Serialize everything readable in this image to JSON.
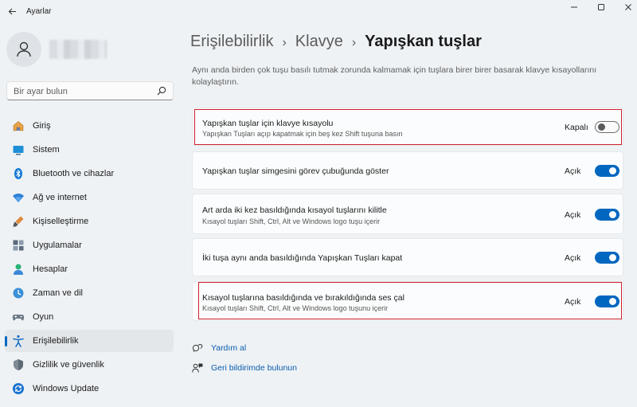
{
  "window": {
    "title": "Ayarlar"
  },
  "search": {
    "placeholder": "Bir ayar bulun"
  },
  "sidebar": {
    "items": [
      {
        "label": "Giriş",
        "icon": "home-icon"
      },
      {
        "label": "Sistem",
        "icon": "system-icon"
      },
      {
        "label": "Bluetooth ve cihazlar",
        "icon": "bluetooth-icon"
      },
      {
        "label": "Ağ ve internet",
        "icon": "wifi-icon"
      },
      {
        "label": "Kişiselleştirme",
        "icon": "brush-icon"
      },
      {
        "label": "Uygulamalar",
        "icon": "apps-icon"
      },
      {
        "label": "Hesaplar",
        "icon": "account-icon"
      },
      {
        "label": "Zaman ve dil",
        "icon": "time-language-icon"
      },
      {
        "label": "Oyun",
        "icon": "gaming-icon"
      },
      {
        "label": "Erişilebilirlik",
        "icon": "accessibility-icon",
        "active": true
      },
      {
        "label": "Gizlilik ve güvenlik",
        "icon": "shield-icon"
      },
      {
        "label": "Windows Update",
        "icon": "update-icon"
      }
    ]
  },
  "breadcrumb": {
    "items": [
      "Erişilebilirlik",
      "Klavye"
    ],
    "current": "Yapışkan tuşlar"
  },
  "description": "Aynı anda birden çok tuşu basılı tutmak zorunda kalmamak için tuşlara birer birer basarak klavye kısayollarını kolaylaştırın.",
  "settings": [
    {
      "title": "Yapışkan tuşlar için klavye kısayolu",
      "subtitle": "Yapışkan Tuşları açıp kapatmak için beş kez Shift tuşuna basın",
      "state": "Kapalı",
      "on": false
    },
    {
      "title": "Yapışkan tuşlar simgesini görev çubuğunda göster",
      "subtitle": "",
      "state": "Açık",
      "on": true
    },
    {
      "title": "Art arda iki kez basıldığında kısayol tuşlarını kilitle",
      "subtitle": "Kısayol tuşları Shift, Ctrl, Alt ve Windows logo tuşu içerir",
      "state": "Açık",
      "on": true
    },
    {
      "title": "İki tuşa aynı anda basıldığında Yapışkan Tuşları kapat",
      "subtitle": "",
      "state": "Açık",
      "on": true
    },
    {
      "title": "Kısayol tuşlarına basıldığında ve bırakıldığında ses çal",
      "subtitle": "Kısayol tuşları Shift, Ctrl, Alt ve Windows logo tuşunu içerir",
      "state": "Açık",
      "on": true
    }
  ],
  "links": {
    "help": "Yardım al",
    "feedback": "Geri bildirimde bulunun"
  },
  "colors": {
    "accent": "#0067c0",
    "highlight": "#d0202b"
  }
}
